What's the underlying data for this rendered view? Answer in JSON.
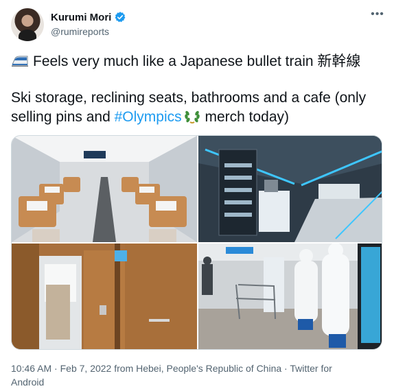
{
  "author": {
    "display_name": "Kurumi Mori",
    "handle": "@rumireports",
    "verified_icon": "verified-badge-icon"
  },
  "tweet": {
    "line1": "Feels very much like a Japanese bullet train 新幹線",
    "line2_part1": "Ski storage, reclining seats, bathrooms and a cafe (only selling pins and ",
    "hashtag": "#Olympics",
    "line2_part2": " merch today)",
    "emoji_start": "bullet-train-emoji",
    "emoji_inline": "olympic-laurel-emoji"
  },
  "media": {
    "photos": [
      "train-interior-seats",
      "train-cafe-car",
      "train-bathroom-doors",
      "station-staff-in-ppe"
    ]
  },
  "meta": {
    "time": "10:46 AM",
    "sep1": " · ",
    "date": "Feb 7, 2022",
    "location": " from Hebei, People's Republic of China",
    "sep2": " · ",
    "client": "Twitter for Android"
  },
  "colors": {
    "link": "#1d9bf0",
    "secondary_text": "#536471",
    "text": "#0f1419"
  }
}
